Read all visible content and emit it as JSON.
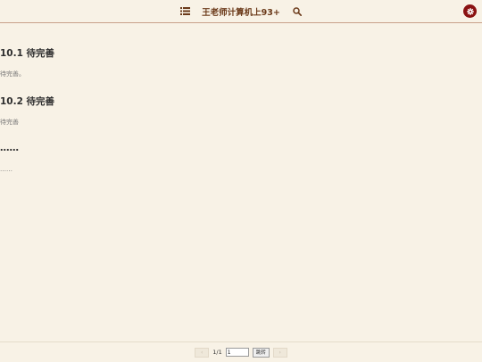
{
  "header": {
    "title": "王老师计算机上93+",
    "menu_icon": "list-icon",
    "search_icon": "search-icon",
    "settings_icon": "gear-icon",
    "accent_color": "#8a1212",
    "title_color": "#6b3a1a"
  },
  "content": {
    "sections": [
      {
        "heading": "10.1 待完善",
        "text": "待完善。"
      },
      {
        "heading": "10.2 待完善",
        "text": "待完善"
      },
      {
        "heading": "……",
        "text": "……"
      }
    ]
  },
  "pager": {
    "page_indicator": "1/1",
    "page_input_value": "1",
    "jump_label": "跳转"
  }
}
